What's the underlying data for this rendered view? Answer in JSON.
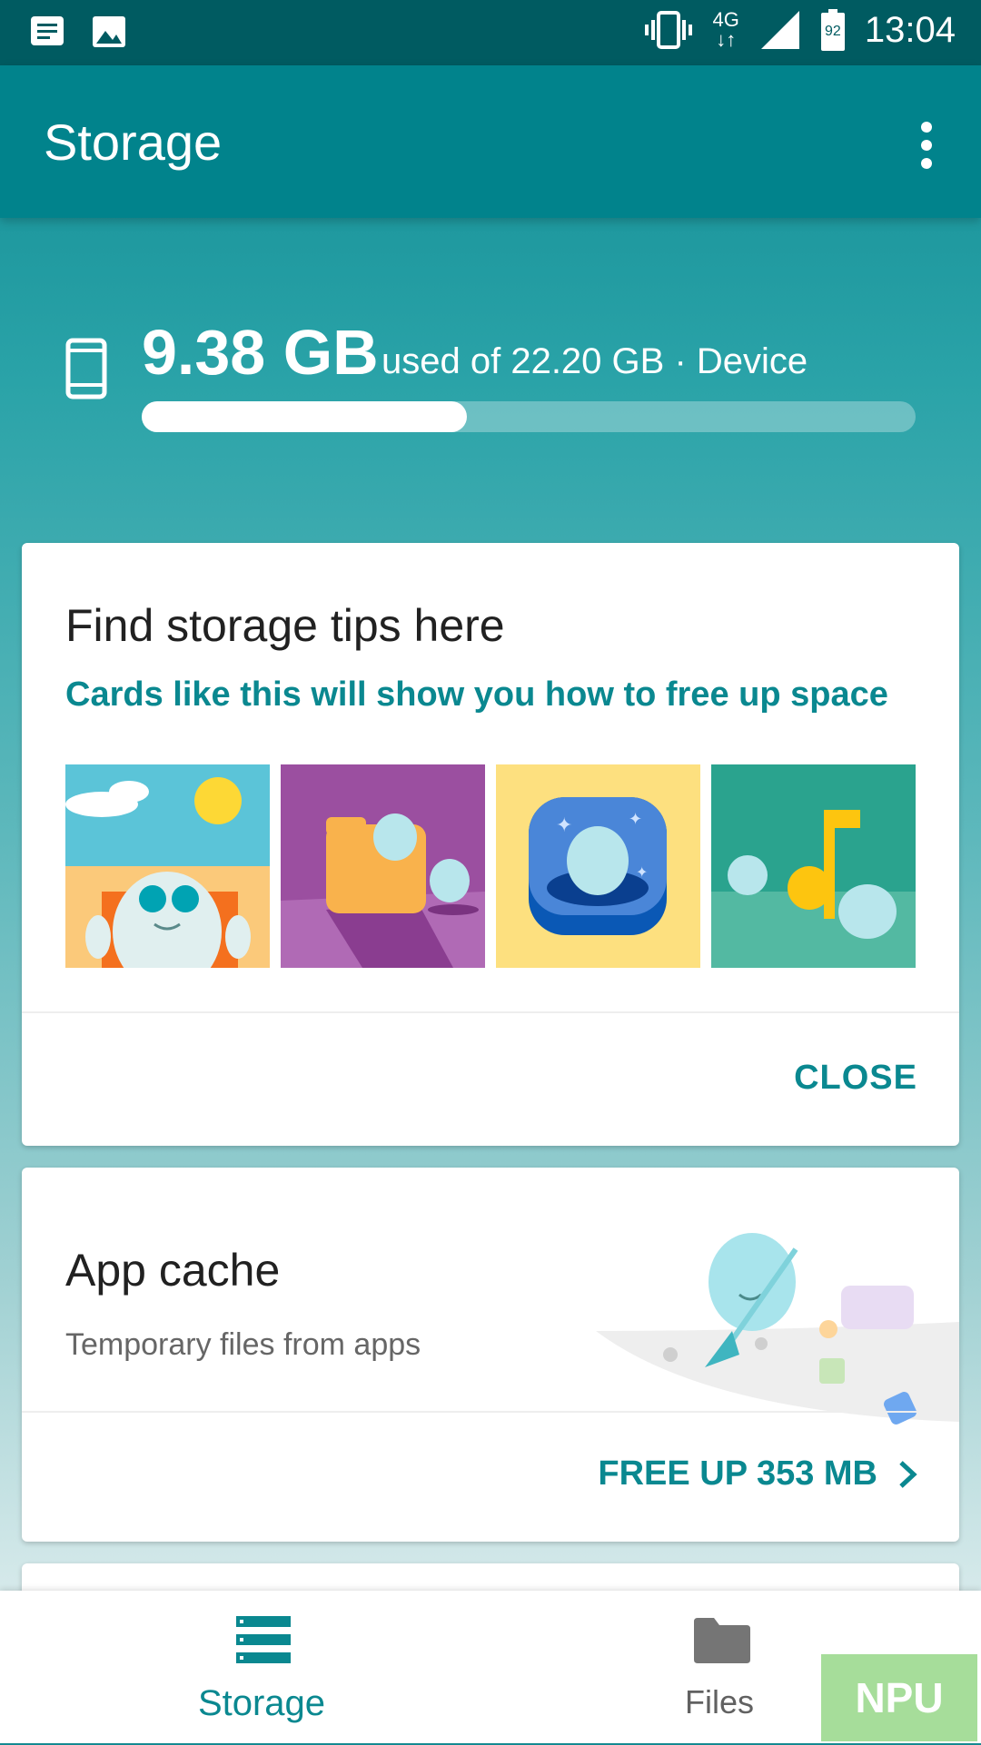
{
  "status_bar": {
    "network": "4G",
    "battery": "92",
    "time": "13:04"
  },
  "app_bar": {
    "title": "Storage"
  },
  "summary": {
    "used": "9.38 GB",
    "used_of": "used of 22.20 GB · Device",
    "fraction_used": 0.42
  },
  "tips_card": {
    "title": "Find storage tips here",
    "subtitle": "Cards like this will show you how to free up space",
    "close_label": "CLOSE"
  },
  "cache_card": {
    "title": "App cache",
    "description": "Temporary files from apps",
    "action_label": "FREE UP 353 MB"
  },
  "bottom_nav": {
    "storage_label": "Storage",
    "files_label": "Files"
  },
  "watermark": {
    "text": "NPU"
  },
  "colors": {
    "accent": "#0a8890",
    "app_bar": "#01838c",
    "status_bar": "#005b61"
  }
}
